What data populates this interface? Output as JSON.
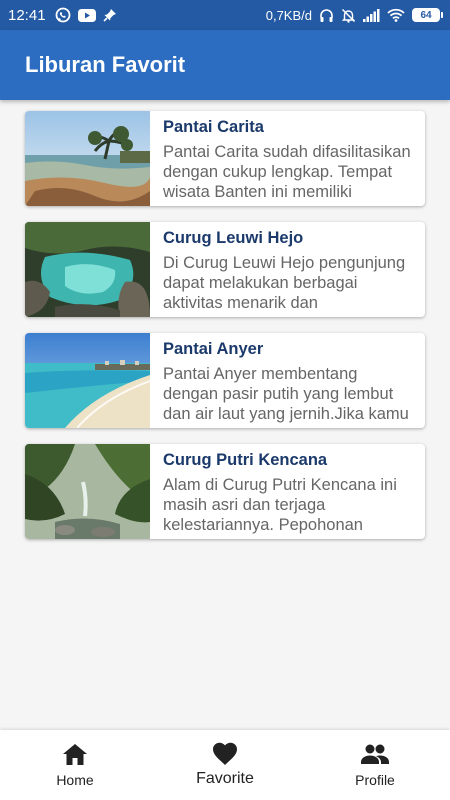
{
  "status_bar": {
    "time": "12:41",
    "left_icons": [
      "whatsapp-icon",
      "youtube-icon",
      "notification-pin-icon"
    ],
    "speed": "0,7KB/d",
    "right_icons": [
      "headset-icon",
      "mute-bell-icon",
      "signal-icon",
      "wifi-icon"
    ],
    "battery": "64",
    "bg_color": "#245aa3"
  },
  "app_bar": {
    "title": "Liburan Favorit",
    "bg_color": "#2c6dc1"
  },
  "places": [
    {
      "title": "Pantai Carita",
      "description": "Pantai Carita sudah difasilitasikan dengan cukup lengkap. Tempat wisata Banten ini memiliki",
      "image": "beach-rocks-tree-photo"
    },
    {
      "title": "Curug Leuwi Hejo",
      "description": "Di Curug Leuwi Hejo pengunjung dapat melakukan berbagai aktivitas menarik dan menyenangkan seperti",
      "image": "green-pool-waterfall-photo"
    },
    {
      "title": "Pantai Anyer",
      "description": "Pantai Anyer membentang dengan pasir putih yang lembut dan air laut yang jernih.Jika kamu berkunjung",
      "image": "white-sand-beach-photo"
    },
    {
      "title": "Curug Putri Kencana",
      "description": "Alam di Curug Putri Kencana ini masih asri dan terjaga kelestariannya. Pepohonan rindang dan udara sejuk",
      "image": "forest-waterfall-photo"
    }
  ],
  "bottom_nav": {
    "items": [
      {
        "label": "Home",
        "icon": "home-icon"
      },
      {
        "label": "Favorite",
        "icon": "heart-icon",
        "active": true
      },
      {
        "label": "Profile",
        "icon": "people-icon"
      }
    ]
  }
}
